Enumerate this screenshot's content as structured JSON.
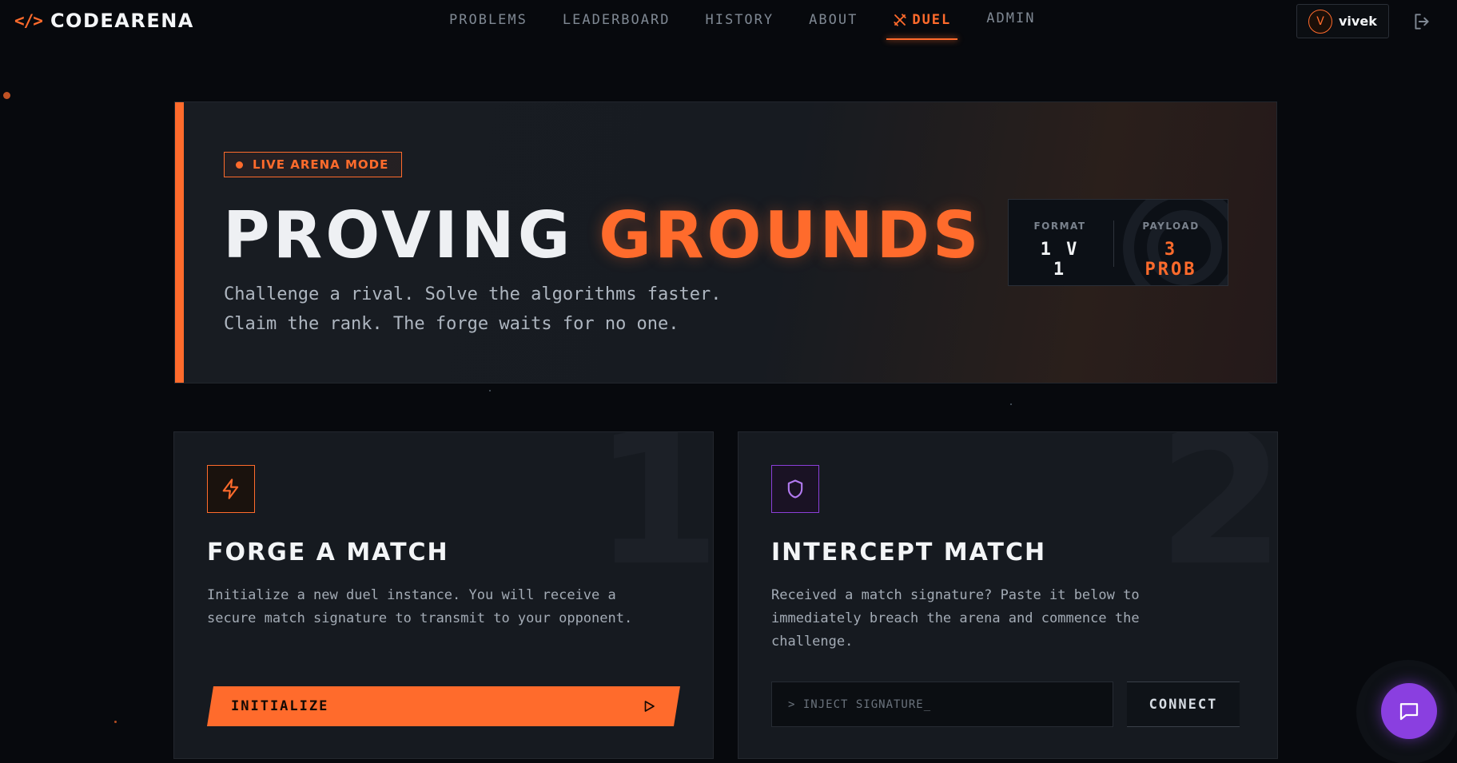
{
  "nav": {
    "brand_glyph": "</>",
    "brand_name": "CODEARENA",
    "items": [
      {
        "label": "PROBLEMS"
      },
      {
        "label": "LEADERBOARD"
      },
      {
        "label": "HISTORY"
      },
      {
        "label": "ABOUT"
      },
      {
        "label": "DUEL",
        "active": true,
        "icon": "crossed-swords-icon"
      },
      {
        "label": "ADMIN"
      }
    ],
    "user": {
      "initial": "V",
      "name": "vivek"
    },
    "logout_icon": "logout-icon"
  },
  "hero": {
    "badge": "LIVE ARENA MODE",
    "title_white": "PROVING",
    "title_accent": "GROUNDS",
    "subtitle_line1": "Challenge a rival. Solve the algorithms faster.",
    "subtitle_line2": "Claim the rank. The forge waits for no one.",
    "stats": {
      "format_label": "FORMAT",
      "format_value": "1 V 1",
      "payload_label": "PAYLOAD",
      "payload_value": "3 PROB"
    }
  },
  "forge_card": {
    "icon": "lightning-icon",
    "watermark": "1",
    "title": "FORGE A MATCH",
    "description": "Initialize a new duel instance. You will receive a secure match signature to transmit to your opponent.",
    "button_label": "INITIALIZE",
    "button_icon": "play-icon"
  },
  "intercept_card": {
    "icon": "shield-icon",
    "watermark": "2",
    "title": "INTERCEPT MATCH",
    "description": "Received a match signature? Paste it below to immediately breach the arena and commence the challenge.",
    "input_placeholder": "> INJECT SIGNATURE_",
    "input_value": "",
    "button_label": "CONNECT"
  },
  "chat": {
    "icon": "chat-bubble-icon"
  },
  "colors": {
    "accent": "#ff6b2c",
    "purple": "#8a3fe0",
    "background": "#07090d",
    "card": "#161a20"
  }
}
